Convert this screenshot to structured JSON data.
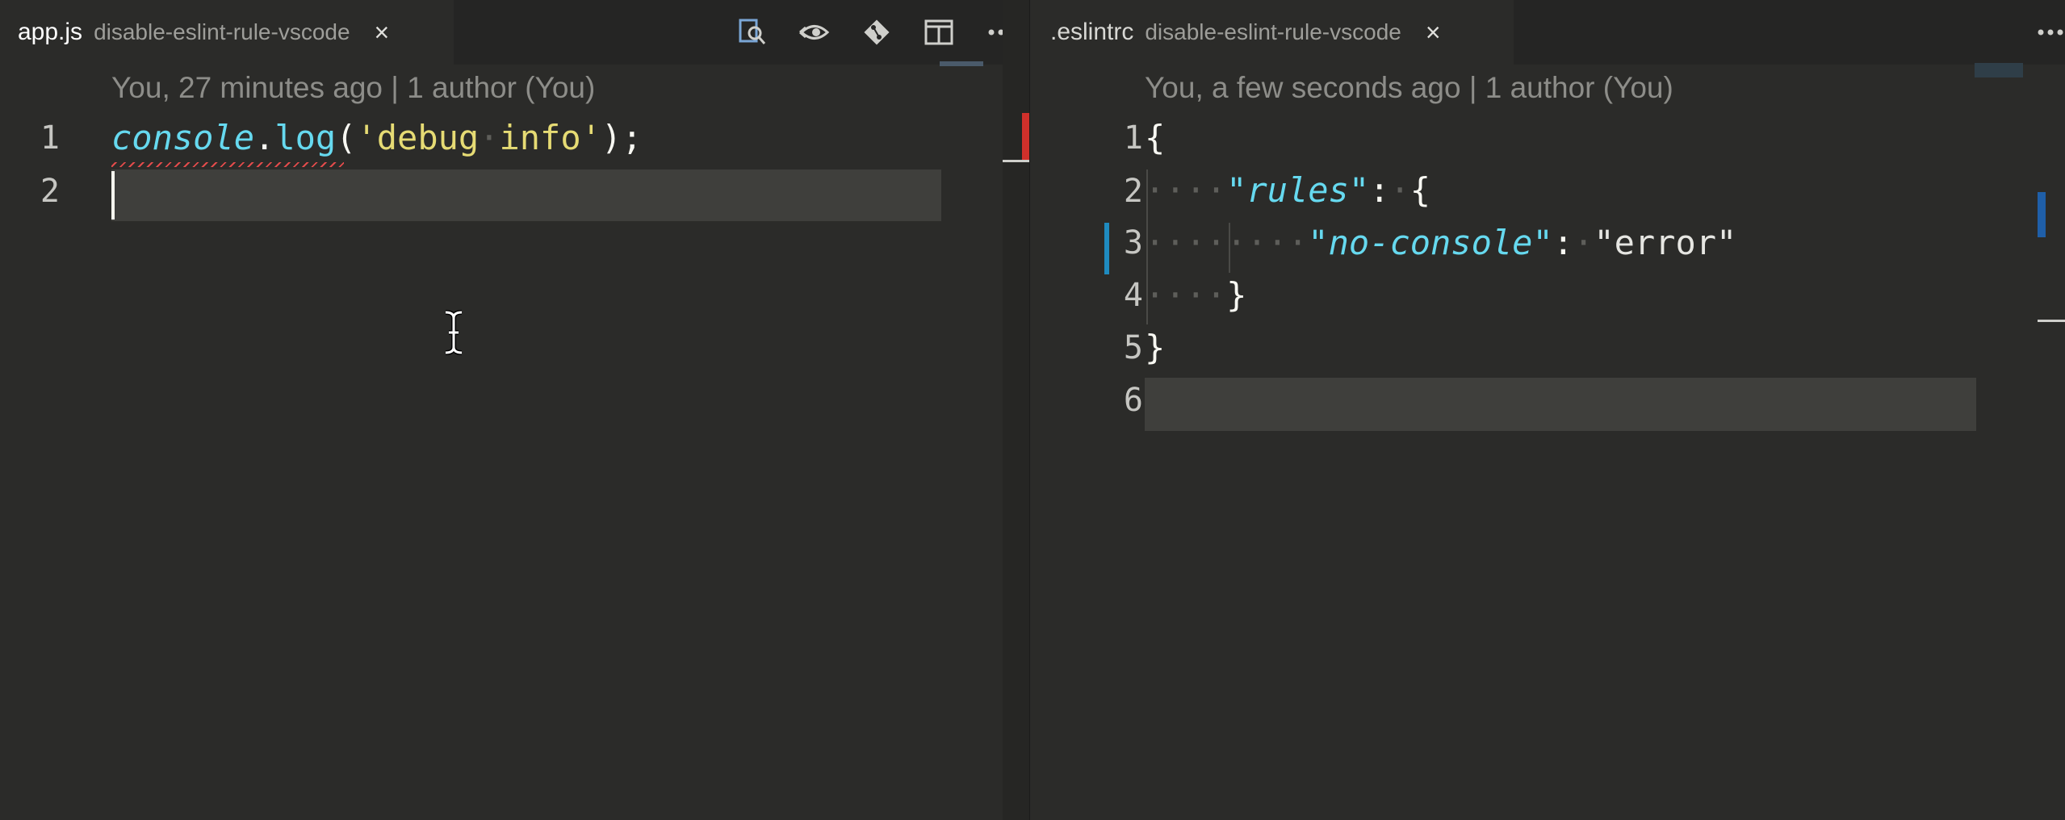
{
  "left_editor": {
    "tab": {
      "filename": "app.js",
      "folder": "disable-eslint-rule-vscode",
      "close_glyph": "×"
    },
    "actions": [
      "open-changes-icon",
      "view-history-icon",
      "git-compare-icon",
      "split-editor-icon",
      "more-actions-icon"
    ],
    "more_glyph": "···",
    "blame": "You, 27 minutes ago | 1 author (You)",
    "lines": [
      {
        "number": "1",
        "tokens": {
          "ident": "console",
          "dot": ".",
          "fn": "log",
          "open": "(",
          "str": "'debug",
          "space": "·",
          "str2": "info'",
          "close": ");"
        }
      },
      {
        "number": "2"
      }
    ]
  },
  "right_editor": {
    "tab": {
      "filename": ".eslintrc",
      "folder": "disable-eslint-rule-vscode",
      "close_glyph": "×"
    },
    "more_glyph": "···",
    "blame": "You, a few seconds ago | 1 author (You)",
    "lines": [
      {
        "number": "1",
        "text": "{"
      },
      {
        "number": "2",
        "indent": "····",
        "key": "\"rules\"",
        "rest": ":",
        "space": "·",
        "brace": "{"
      },
      {
        "number": "3",
        "indent": "········",
        "key": "\"no-console\"",
        "rest": ":",
        "space": "·",
        "value": "\"error\""
      },
      {
        "number": "4",
        "indent": "····",
        "text": "}"
      },
      {
        "number": "5",
        "text": "}"
      },
      {
        "number": "6",
        "text": ""
      }
    ]
  },
  "colors": {
    "editor_bg": "#2b2b29",
    "tab_bar_bg": "#252524",
    "current_line": "#3f3f3c",
    "error_marker": "#d0302b",
    "git_modified": "#1f8bbf"
  }
}
